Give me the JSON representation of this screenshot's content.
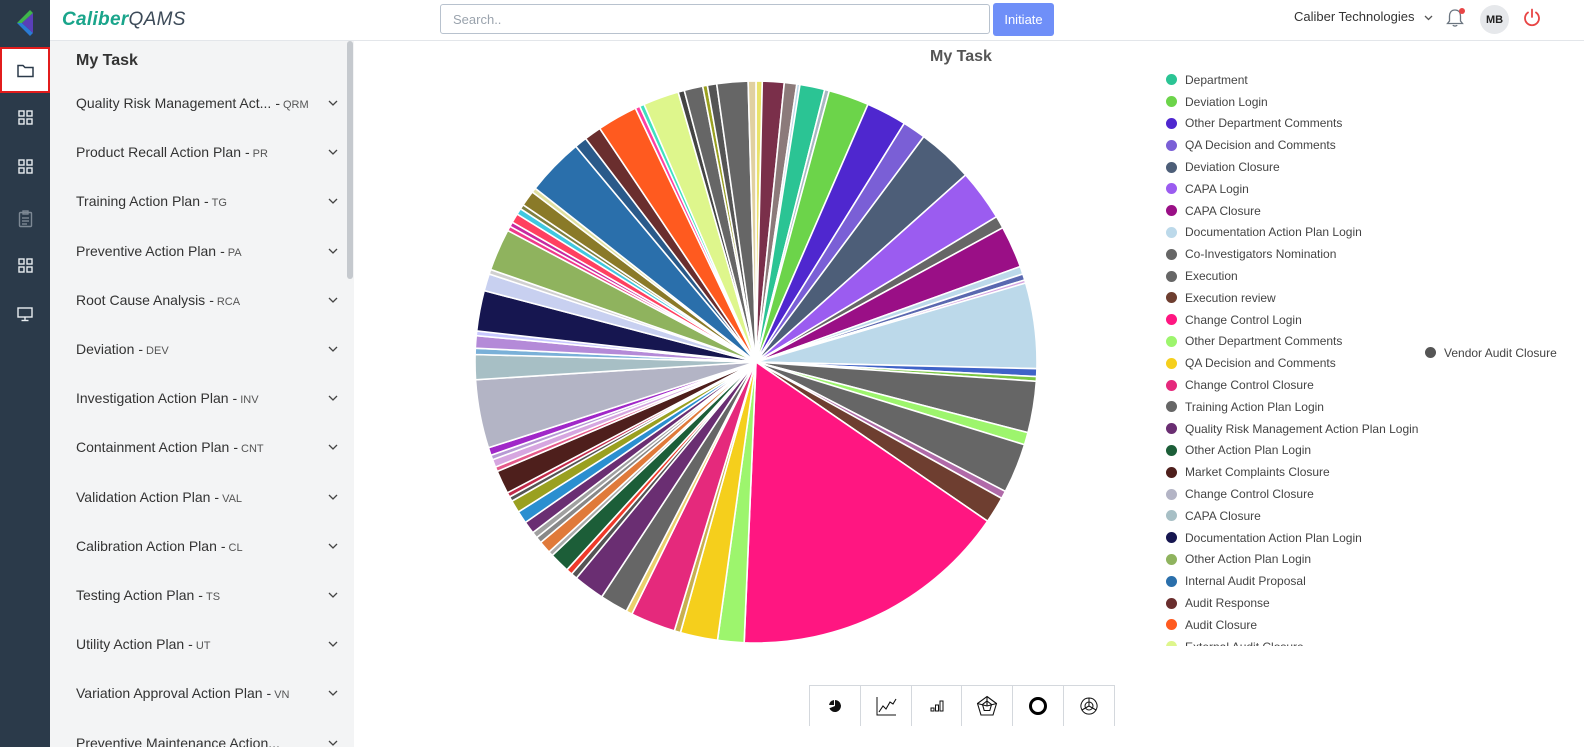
{
  "header": {
    "brand_part1": "Caliber",
    "brand_part2": "QAMS",
    "search_placeholder": "Search..",
    "initiate_label": "Initiate",
    "company": "Caliber Technologies",
    "user_initials": "MB"
  },
  "rail": {
    "items": [
      {
        "icon": "folder-icon",
        "active": true
      },
      {
        "icon": "grid-icon",
        "active": false
      },
      {
        "icon": "grid-icon",
        "active": false
      },
      {
        "icon": "clipboard-icon",
        "active": false
      },
      {
        "icon": "grid-icon",
        "active": false
      },
      {
        "icon": "monitor-icon",
        "active": false
      }
    ]
  },
  "task_menu": {
    "title": "My Task",
    "items": [
      {
        "label": "Quality Risk Management Act...",
        "code": "QRM"
      },
      {
        "label": "Product Recall Action Plan",
        "code": "PR"
      },
      {
        "label": "Training Action Plan",
        "code": "TG"
      },
      {
        "label": "Preventive Action Plan",
        "code": "PA"
      },
      {
        "label": "Root Cause Analysis",
        "code": "RCA"
      },
      {
        "label": "Deviation",
        "code": "DEV"
      },
      {
        "label": "Investigation Action Plan",
        "code": "INV"
      },
      {
        "label": "Containment Action Plan",
        "code": "CNT"
      },
      {
        "label": "Validation Action Plan",
        "code": "VAL"
      },
      {
        "label": "Calibration Action Plan",
        "code": "CL"
      },
      {
        "label": "Testing Action Plan",
        "code": "TS"
      },
      {
        "label": "Utility Action Plan",
        "code": "UT"
      },
      {
        "label": "Variation Approval Action Plan",
        "code": "VN"
      },
      {
        "label": "Preventive Maintenance Action...",
        "code": ""
      }
    ]
  },
  "chart": {
    "title": "My Task",
    "legend": [
      {
        "label": "Department",
        "color": "#2bc494"
      },
      {
        "label": "Deviation Login",
        "color": "#6cd44a"
      },
      {
        "label": "Other Department Comments",
        "color": "#4f27cf"
      },
      {
        "label": "QA Decision and Comments",
        "color": "#7a5fd6"
      },
      {
        "label": "Deviation Closure",
        "color": "#4d5e78"
      },
      {
        "label": "CAPA Login",
        "color": "#9b5cf0"
      },
      {
        "label": "CAPA Closure",
        "color": "#9a0f86"
      },
      {
        "label": "Documentation Action Plan Login",
        "color": "#bcd9ea"
      },
      {
        "label": "Co-Investigators Nomination",
        "color": "#666666"
      },
      {
        "label": "Execution",
        "color": "#666666"
      },
      {
        "label": "Execution review",
        "color": "#6e3e30"
      },
      {
        "label": "Change Control Login",
        "color": "#ff1681"
      },
      {
        "label": "Other Department Comments",
        "color": "#9df56d"
      },
      {
        "label": "QA Decision and Comments",
        "color": "#f5cf1c"
      },
      {
        "label": "Change Control Closure",
        "color": "#e5297c"
      },
      {
        "label": "Training Action Plan Login",
        "color": "#666666"
      },
      {
        "label": "Quality Risk Management Action Plan Login",
        "color": "#6a2e72"
      },
      {
        "label": "Other Action Plan Login",
        "color": "#1c5e38"
      },
      {
        "label": "Market Complaints Closure",
        "color": "#4e1f1c"
      },
      {
        "label": "Change Control Closure",
        "color": "#b3b4c5"
      },
      {
        "label": "CAPA Closure",
        "color": "#a7bfc5"
      },
      {
        "label": "Documentation Action Plan Login",
        "color": "#161650"
      },
      {
        "label": "Other Action Plan Login",
        "color": "#8fb35e"
      },
      {
        "label": "Internal Audit Proposal",
        "color": "#2a6fab"
      },
      {
        "label": "Audit Response",
        "color": "#6a2e2e"
      },
      {
        "label": "Audit Closure",
        "color": "#ff5a1f"
      },
      {
        "label": "External Audit Closure",
        "color": "#def68c"
      }
    ],
    "legend_page2": {
      "label": "Vendor Audit Closure",
      "color": "#555555"
    },
    "tools": [
      {
        "icon": "pie-chart-icon"
      },
      {
        "icon": "line-chart-icon"
      },
      {
        "icon": "bar-chart-icon"
      },
      {
        "icon": "radar-chart-icon"
      },
      {
        "icon": "doughnut-chart-icon"
      },
      {
        "icon": "polar-area-chart-icon"
      }
    ]
  },
  "chart_data": {
    "type": "pie",
    "title": "My Task",
    "slices": [
      {
        "value": 0.4,
        "color": "#e9e26a"
      },
      {
        "value": 1.4,
        "color": "#7a2f4a"
      },
      {
        "value": 0.8,
        "color": "#8c7a7a"
      },
      {
        "value": 0.2,
        "color": "#bcd9ea"
      },
      {
        "value": 1.6,
        "color": "#2bc494"
      },
      {
        "value": 0.3,
        "color": "#aab8c2"
      },
      {
        "value": 2.6,
        "color": "#6cd44a"
      },
      {
        "value": 2.6,
        "color": "#4f27cf"
      },
      {
        "value": 1.5,
        "color": "#7a5fd6"
      },
      {
        "value": 3.6,
        "color": "#4d5e78"
      },
      {
        "value": 3.3,
        "color": "#9b5cf0"
      },
      {
        "value": 0.8,
        "color": "#666666"
      },
      {
        "value": 2.7,
        "color": "#9a0f86"
      },
      {
        "value": 0.5,
        "color": "#bcd9ea"
      },
      {
        "value": 0.4,
        "color": "#5a68b0"
      },
      {
        "value": 0.2,
        "color": "#d6a6e0"
      },
      {
        "value": 5.5,
        "color": "#bcd9ea"
      },
      {
        "value": 0.5,
        "color": "#3f63c8"
      },
      {
        "value": 0.3,
        "color": "#7bc744"
      },
      {
        "value": 3.3,
        "color": "#666666"
      },
      {
        "value": 0.8,
        "color": "#9df56d"
      },
      {
        "value": 3.2,
        "color": "#666666"
      },
      {
        "value": 0.5,
        "color": "#b06aa8"
      },
      {
        "value": 1.7,
        "color": "#6e3e30"
      },
      {
        "value": 18.0,
        "color": "#ff1681"
      },
      {
        "value": 1.7,
        "color": "#9df56d"
      },
      {
        "value": 2.4,
        "color": "#f5cf1c"
      },
      {
        "value": 0.4,
        "color": "#c8b050"
      },
      {
        "value": 2.9,
        "color": "#e5297c"
      },
      {
        "value": 0.4,
        "color": "#ead06c"
      },
      {
        "value": 1.8,
        "color": "#666666"
      },
      {
        "value": 2.0,
        "color": "#6a2e72"
      },
      {
        "value": 0.4,
        "color": "#555555"
      },
      {
        "value": 0.4,
        "color": "#ef3a2a"
      },
      {
        "value": 1.3,
        "color": "#1c5e38"
      },
      {
        "value": 0.3,
        "color": "#aaaaaa"
      },
      {
        "value": 0.8,
        "color": "#e07a3a"
      },
      {
        "value": 0.4,
        "color": "#888888"
      },
      {
        "value": 0.4,
        "color": "#a0a0a0"
      },
      {
        "value": 0.8,
        "color": "#6a2e72"
      },
      {
        "value": 0.8,
        "color": "#2a8fd0"
      },
      {
        "value": 0.8,
        "color": "#9aa020"
      },
      {
        "value": 0.3,
        "color": "#555555"
      },
      {
        "value": 0.3,
        "color": "#c02a4a"
      },
      {
        "value": 1.5,
        "color": "#4e1f1c"
      },
      {
        "value": 0.3,
        "color": "#e45a8a"
      },
      {
        "value": 0.5,
        "color": "#d6a6e0"
      },
      {
        "value": 0.3,
        "color": "#b69ad4"
      },
      {
        "value": 0.5,
        "color": "#a028c8"
      },
      {
        "value": 4.4,
        "color": "#b3b4c5"
      },
      {
        "value": 1.6,
        "color": "#a7bfc5"
      },
      {
        "value": 0.4,
        "color": "#7ab0d8"
      },
      {
        "value": 0.8,
        "color": "#b48ad8"
      },
      {
        "value": 0.3,
        "color": "#c8c8ff"
      },
      {
        "value": 2.6,
        "color": "#161650"
      },
      {
        "value": 1.1,
        "color": "#c8d0f0"
      },
      {
        "value": 0.3,
        "color": "#d0d0d0"
      },
      {
        "value": 2.7,
        "color": "#8fb35e"
      },
      {
        "value": 0.3,
        "color": "#ef3a8a"
      },
      {
        "value": 0.3,
        "color": "#c828a0"
      },
      {
        "value": 0.6,
        "color": "#ff4060"
      },
      {
        "value": 0.4,
        "color": "#40c8e0"
      },
      {
        "value": 0.3,
        "color": "#808040"
      },
      {
        "value": 1.0,
        "color": "#8a7a28"
      },
      {
        "value": 0.3,
        "color": "#e0e0a0"
      },
      {
        "value": 3.7,
        "color": "#2a6fab"
      },
      {
        "value": 0.8,
        "color": "#2a5a8a"
      },
      {
        "value": 1.1,
        "color": "#6a2e2e"
      },
      {
        "value": 2.6,
        "color": "#ff5a1f"
      },
      {
        "value": 0.3,
        "color": "#ff40a0"
      },
      {
        "value": 0.3,
        "color": "#40e0c0"
      },
      {
        "value": 2.3,
        "color": "#def68c"
      },
      {
        "value": 0.4,
        "color": "#444444"
      },
      {
        "value": 1.2,
        "color": "#666666"
      },
      {
        "value": 0.3,
        "color": "#9aa020"
      },
      {
        "value": 0.6,
        "color": "#555555"
      },
      {
        "value": 2.0,
        "color": "#666666"
      },
      {
        "value": 0.5,
        "color": "#e0d0a0"
      }
    ]
  }
}
